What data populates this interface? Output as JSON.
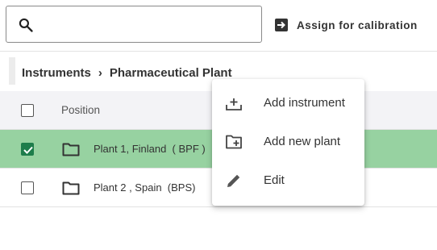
{
  "search": {
    "placeholder": "",
    "value": ""
  },
  "toolbar": {
    "assign_label": "Assign for calibration"
  },
  "breadcrumb": {
    "items": [
      "Instruments",
      "Pharmaceutical Plant"
    ],
    "separator": "›"
  },
  "table": {
    "header": {
      "position_label": "Position"
    },
    "rows": [
      {
        "name": "Plant 1, Finland  ( BPF )",
        "selected": true
      },
      {
        "name": "Plant 2 , Spain  (BPS)",
        "selected": false
      }
    ]
  },
  "context_menu": {
    "items": [
      {
        "label": "Add instrument",
        "icon": "add-instrument-icon"
      },
      {
        "label": "Add new plant",
        "icon": "add-folder-icon"
      },
      {
        "label": "Edit",
        "icon": "pencil-icon"
      }
    ]
  },
  "colors": {
    "selected_row": "#97d2a1",
    "checkbox_checked": "#1e7d4b",
    "header_bg": "#f3f3f6"
  }
}
